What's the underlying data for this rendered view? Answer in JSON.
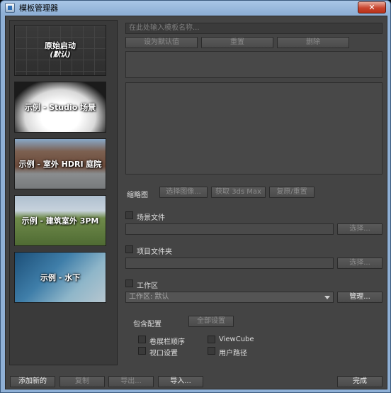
{
  "window": {
    "title": "模板管理器",
    "close_glyph": "✕"
  },
  "templates": [
    {
      "label": "原始启动",
      "sublabel": "(默认)"
    },
    {
      "label": "示例 - Studio 场景",
      "sublabel": ""
    },
    {
      "label": "示例 - 室外 HDRI 庭院",
      "sublabel": ""
    },
    {
      "label": "示例 - 建筑室外 3PM",
      "sublabel": ""
    },
    {
      "label": "示例 - 水下",
      "sublabel": ""
    }
  ],
  "name_input": {
    "placeholder": "在此处输入模板名称..."
  },
  "top_buttons": {
    "set_default": "设为默认值",
    "reset": "重置",
    "delete": "删除"
  },
  "thumbnail": {
    "label": "缩略图",
    "choose_image": "选择图像...",
    "capture_max": "获取 3ds Max",
    "restore_reset": "复原/重置"
  },
  "scene_file": {
    "label": "场景文件",
    "choose": "选择..."
  },
  "project_folder": {
    "label": "项目文件夹",
    "choose": "选择..."
  },
  "workspace": {
    "label": "工作区",
    "value": "工作区: 默认",
    "manage": "管理..."
  },
  "include_config": {
    "label": "包含配置",
    "select_all": "全部设置",
    "options": {
      "rollout_order": "卷展栏顺序",
      "viewcube": "ViewCube",
      "viewport_settings": "视口设置",
      "user_paths": "用户路径"
    }
  },
  "bottom_buttons": {
    "add_new": "添加新的",
    "copy": "复制",
    "export": "导出...",
    "import": "导入...",
    "done": "完成"
  }
}
